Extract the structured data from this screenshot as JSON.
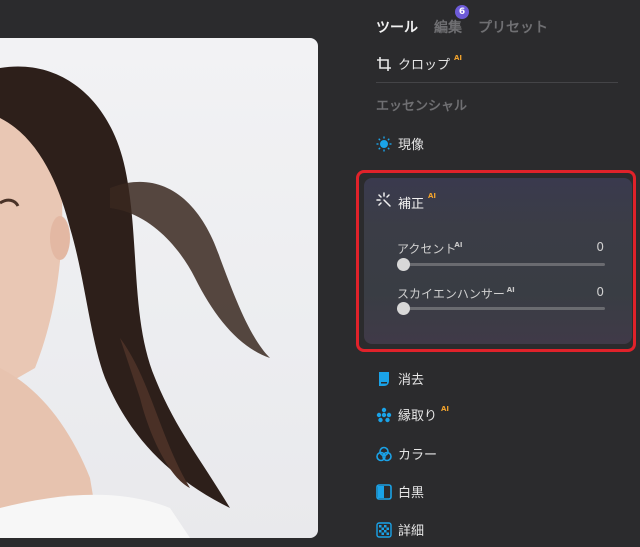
{
  "tabs": [
    {
      "label": "ツール",
      "active": true
    },
    {
      "label": "編集",
      "badge": "6"
    },
    {
      "label": "プリセット"
    }
  ],
  "crop": {
    "label": "クロップ",
    "ai": "AI",
    "icon": "crop-icon"
  },
  "section_title": "エッセンシャル",
  "develop": {
    "label": "現像",
    "icon": "sun-icon"
  },
  "enhance": {
    "label": "補正",
    "ai": "AI",
    "icon": "magic-wand-icon",
    "sliders": [
      {
        "label": "アクセント",
        "ai": "AI",
        "value": "0",
        "level": 0
      },
      {
        "label": "スカイエンハンサー",
        "ai": "AI",
        "value": "0",
        "level": 0
      }
    ]
  },
  "tools": [
    {
      "label": "消去",
      "icon": "eraser-icon"
    },
    {
      "label": "縁取り",
      "ai": "AI",
      "icon": "dots-icon"
    },
    {
      "label": "カラー",
      "icon": "color-circles-icon"
    },
    {
      "label": "白黒",
      "icon": "bw-square-icon"
    },
    {
      "label": "詳細",
      "icon": "checker-icon"
    }
  ],
  "colors": {
    "accent": "#1aa3e8",
    "ai_badge": "#f0a22d",
    "highlight": "#e0222a",
    "tab_badge": "#6d5bd8"
  }
}
